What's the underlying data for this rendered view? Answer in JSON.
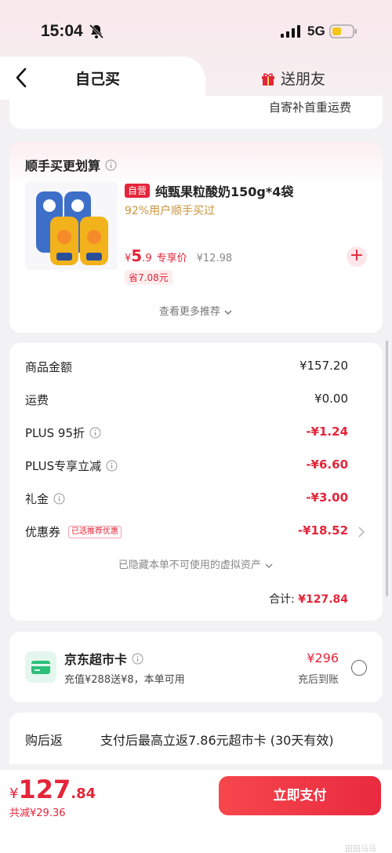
{
  "status_bar": {
    "time": "15:04",
    "network": "5G"
  },
  "tabs": {
    "self_buy": "自己买",
    "gift_friend": "送朋友"
  },
  "shipping": {
    "text": "自寄补首重运费"
  },
  "recommend": {
    "title": "顺手买更划算",
    "badge": "自营",
    "product_name": "纯甄果粒酸奶150g*4袋",
    "subtitle": "92%用户顺手买过",
    "price_symbol": "¥",
    "price_int": "5",
    "price_dec": ".9",
    "price_tag": "专享价",
    "original_price": "¥12.98",
    "save": "省7.08元",
    "more": "查看更多推荐"
  },
  "summary": {
    "rows": [
      {
        "label": "商品金额",
        "value": "¥157.20",
        "red": false,
        "info": false
      },
      {
        "label": "运费",
        "value": "¥0.00",
        "red": false,
        "info": false
      },
      {
        "label": "PLUS 95折",
        "value": "-¥1.24",
        "red": true,
        "info": true
      },
      {
        "label": "PLUS专享立减",
        "value": "-¥6.60",
        "red": true,
        "info": true
      },
      {
        "label": "礼金",
        "value": "-¥3.00",
        "red": true,
        "info": true
      },
      {
        "label": "优惠券",
        "value": "-¥18.52",
        "red": true,
        "info": false,
        "badge": "已选推荐优惠"
      }
    ],
    "hidden_note": "已隐藏本单不可使用的虚拟资产",
    "total_label": "合计:",
    "total_value": "¥127.84"
  },
  "supermarket_card": {
    "title": "京东超市卡",
    "subtitle": "充值¥288送¥8，本单可用",
    "price": "¥296",
    "note": "充后到账"
  },
  "cashback": {
    "label": "购后返",
    "text": "支付后最高立返7.86元超市卡 (30天有效)"
  },
  "bottom": {
    "price_symbol": "¥",
    "price_int": "127",
    "price_dec": ".84",
    "total_save": "共减¥29.36",
    "pay_button": "立即支付",
    "watermark": "田田马马"
  },
  "colors": {
    "accent": "#e4253a",
    "gold": "#c9943d"
  }
}
